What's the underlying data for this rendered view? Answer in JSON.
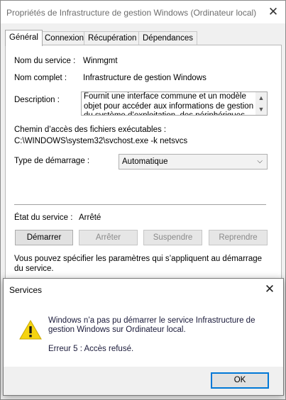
{
  "window": {
    "title": "Propriétés de Infrastructure de gestion Windows (Ordinateur local)",
    "close_glyph": "✕"
  },
  "tabs": [
    {
      "label": "Général",
      "active": true
    },
    {
      "label": "Connexion",
      "active": false
    },
    {
      "label": "Récupération",
      "active": false
    },
    {
      "label": "Dépendances",
      "active": false
    }
  ],
  "general": {
    "service_name_label": "Nom du service :",
    "service_name_value": "Winmgmt",
    "display_name_label": "Nom complet :",
    "display_name_value": "Infrastructure de gestion Windows",
    "description_label": "Description :",
    "description_value": "Fournit une interface commune et un modèle objet pour accéder aux informations de gestion du système d’exploitation, des périphériques, des",
    "path_label": "Chemin d’accès des fichiers exécutables :",
    "path_value": "C:\\WINDOWS\\system32\\svchost.exe -k netsvcs",
    "startup_type_label": "Type de démarrage :",
    "startup_type_value": "Automatique",
    "status_label": "État du service :",
    "status_value": "Arrêté",
    "buttons": {
      "start": "Démarrer",
      "stop": "Arrêter",
      "pause": "Suspendre",
      "resume": "Reprendre"
    },
    "params_text": "Vous pouvez spécifier les paramètres qui s’appliquent au démarrage du service."
  },
  "dialog": {
    "title": "Services",
    "close_glyph": "✕",
    "message": "Windows n’a pas pu démarrer le service Infrastructure de gestion Windows sur Ordinateur local.",
    "error": "Erreur 5 : Accès refusé.",
    "ok_label": "OK",
    "icon": "warning-icon"
  },
  "colors": {
    "warning_fill": "#f5d410",
    "focus_border": "#0078d7"
  }
}
